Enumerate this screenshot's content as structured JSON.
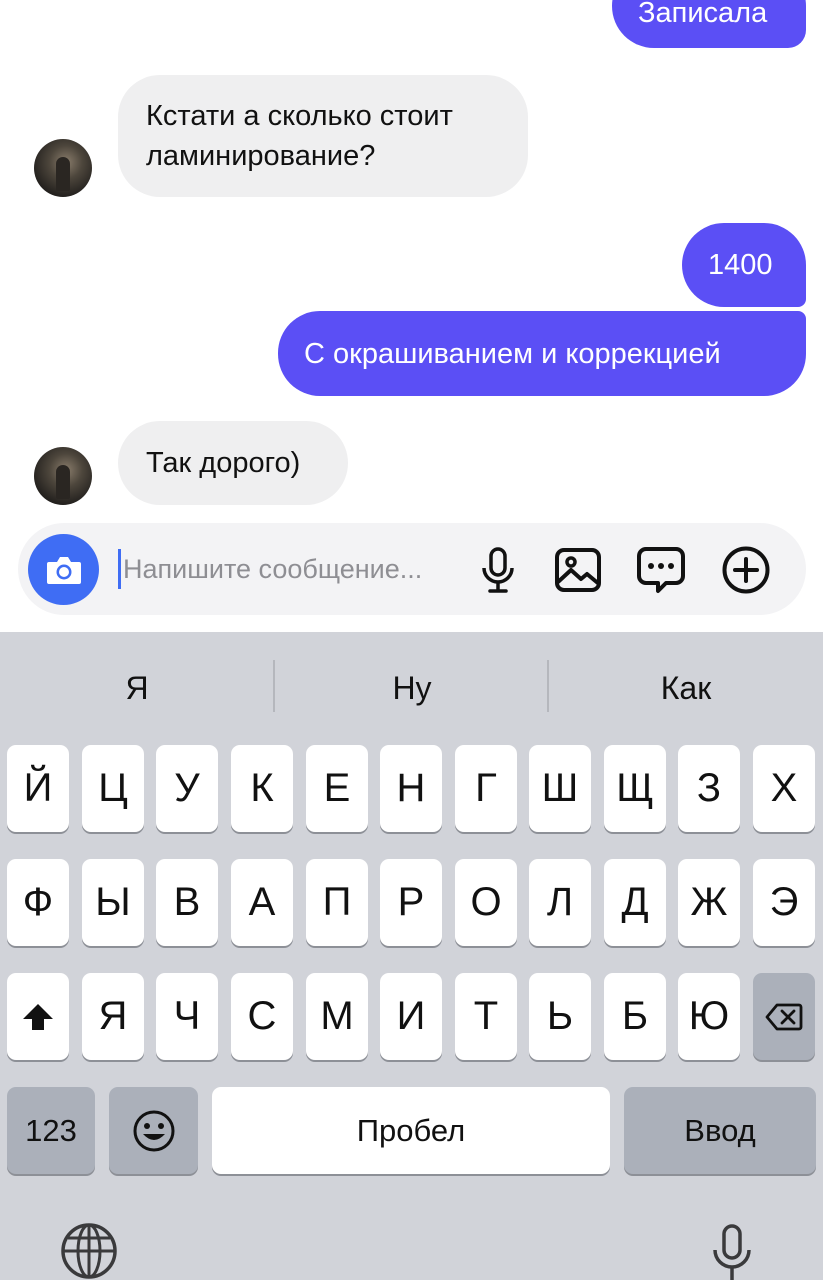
{
  "messages": [
    {
      "side": "out",
      "text": "Записала"
    },
    {
      "side": "in",
      "text_lines": [
        "Кстати а сколько стоит",
        "ламинирование?"
      ]
    },
    {
      "side": "out",
      "text": "1400"
    },
    {
      "side": "out",
      "text": "С окрашиванием и коррекцией"
    },
    {
      "side": "in",
      "text": "Так дорого)"
    }
  ],
  "composer": {
    "placeholder": "Напишите сообщение...",
    "icons": [
      "camera-icon",
      "microphone-icon",
      "image-icon",
      "chat-bubble-icon",
      "plus-circle-icon"
    ]
  },
  "keyboard": {
    "suggestions": [
      "Я",
      "Ну",
      "Как"
    ],
    "row1": [
      "Й",
      "Ц",
      "У",
      "К",
      "Е",
      "Н",
      "Г",
      "Ш",
      "Щ",
      "З",
      "Х"
    ],
    "row2": [
      "Ф",
      "Ы",
      "В",
      "А",
      "П",
      "Р",
      "О",
      "Л",
      "Д",
      "Ж",
      "Э"
    ],
    "row3": [
      "Я",
      "Ч",
      "С",
      "М",
      "И",
      "Т",
      "Ь",
      "Б",
      "Ю"
    ],
    "numbers_label": "123",
    "space_label": "Пробел",
    "return_label": "Ввод",
    "icons": [
      "shift-icon",
      "backspace-icon",
      "emoji-icon",
      "globe-icon",
      "dictation-mic-icon"
    ]
  },
  "colors": {
    "outgoing_bubble": "#5b4ff5",
    "incoming_bubble": "#efeff0",
    "accent": "#3f6df4",
    "keyboard_bg": "#d1d3d9"
  }
}
